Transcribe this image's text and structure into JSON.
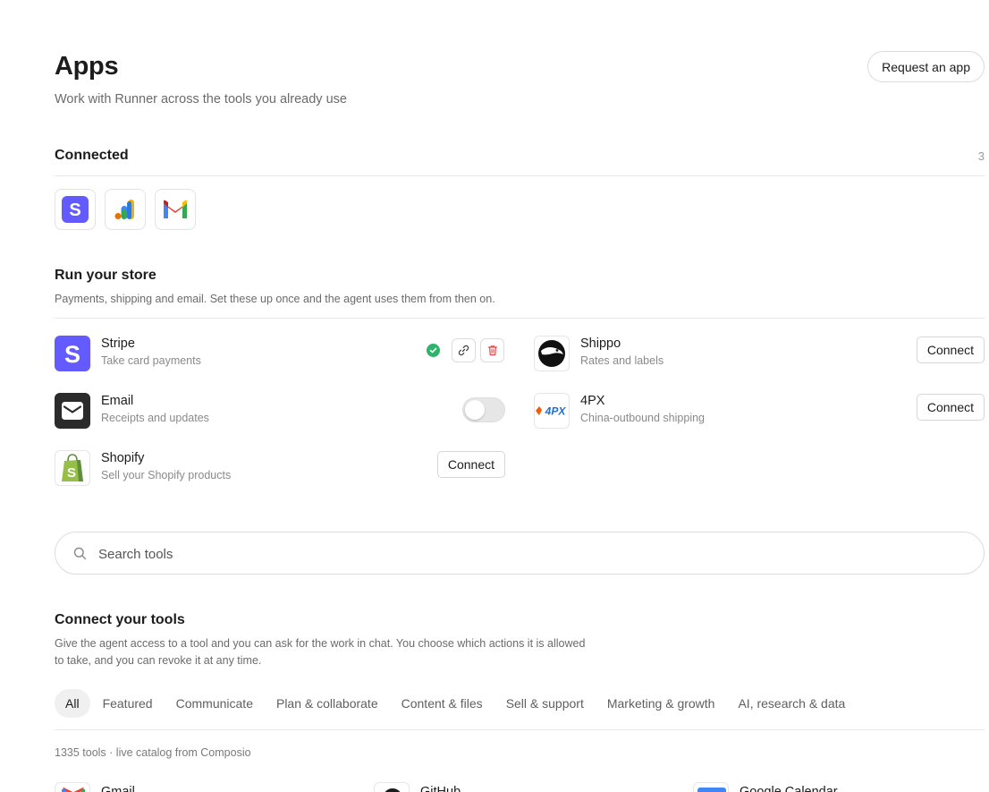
{
  "header": {
    "title": "Apps",
    "subtitle": "Work with Runner across the tools you already use",
    "request_label": "Request an app"
  },
  "connected": {
    "title": "Connected",
    "count": "3",
    "icons": [
      "stripe-icon",
      "google-analytics-icon",
      "gmail-icon"
    ]
  },
  "store": {
    "title": "Run your store",
    "description": "Payments, shipping and email. Set these up once and the agent uses them from then on.",
    "apps": [
      {
        "name": "Stripe",
        "desc": "Take card payments",
        "state": "connected"
      },
      {
        "name": "Shippo",
        "desc": "Rates and labels",
        "action": "Connect"
      },
      {
        "name": "Email",
        "desc": "Receipts and updates",
        "state": "off"
      },
      {
        "name": "4PX",
        "desc": "China-outbound shipping",
        "action": "Connect",
        "logo_text": "4PX"
      },
      {
        "name": "Shopify",
        "desc": "Sell your Shopify products",
        "action": "Connect"
      }
    ]
  },
  "search": {
    "placeholder": "Search tools"
  },
  "tools": {
    "title": "Connect your tools",
    "description_line1": "Give the agent access to a tool and you can ask for the work in chat. You choose which actions it is allowed",
    "description_line2": "to take, and you can revoke it at any time.",
    "tabs": [
      "All",
      "Featured",
      "Communicate",
      "Plan & collaborate",
      "Content & files",
      "Sell & support",
      "Marketing & growth",
      "AI, research & data"
    ],
    "active_tab": "All",
    "catalog_note": "1335 tools · live catalog from Composio",
    "peek": [
      "Gmail",
      "GitHub",
      "Google Calendar"
    ]
  },
  "colors": {
    "stripe": "#635bff",
    "success": "#2fb36b",
    "danger": "#e5484d",
    "shopify": "#95bf47"
  }
}
